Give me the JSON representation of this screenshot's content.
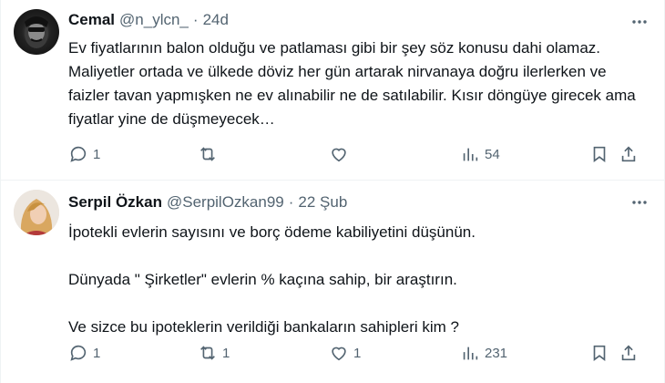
{
  "tweets": [
    {
      "name": "Cemal",
      "handle": "@n_ylcn_",
      "separator": "·",
      "date": "24d",
      "text": [
        "Ev fiyatlarının balon olduğu ve  patlaması gibi bir şey söz konusu dahi olamaz. Maliyetler ortada ve ülkede döviz her gün artarak nirvanaya doğru ilerlerken ve faizler tavan yapmışken ne ev alınabilir ne de satılabilir. Kısır döngüye girecek ama fiyatlar yine de düşmeyecek…"
      ],
      "replies": "1",
      "retweets": "",
      "likes": "",
      "views": "54",
      "avatar_icon": "avatar-dark-face"
    },
    {
      "name": "Serpil Özkan",
      "handle": "@SerpilOzkan99",
      "separator": "·",
      "date": "22 Şub",
      "text": [
        "İpotekli evlerin sayısını ve borç ödeme kabiliyetini düşünün.",
        "Dünyada \" Şirketler\" evlerin % kaçına sahip, bir araştırın.",
        "Ve sizce bu ipoteklerin verildiği bankaların sahipleri kim ?"
      ],
      "replies": "1",
      "retweets": "1",
      "likes": "1",
      "views": "231",
      "avatar_icon": "avatar-blonde-woman"
    }
  ],
  "icons": {
    "more": "more-icon",
    "reply": "reply-icon",
    "retweet": "retweet-icon",
    "like": "like-icon",
    "views": "views-icon",
    "bookmark": "bookmark-icon",
    "share": "share-icon"
  },
  "colors": {
    "text": "#0f1419",
    "secondary": "#536471",
    "divider": "#eff3f4"
  }
}
